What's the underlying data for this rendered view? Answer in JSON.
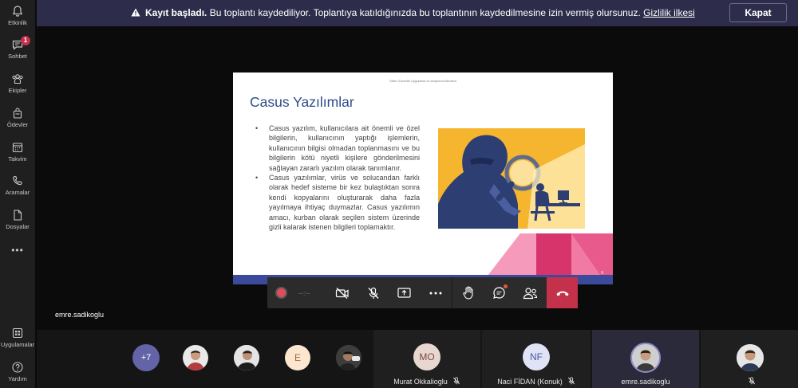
{
  "rail": {
    "items": [
      {
        "label": "Etkinlik",
        "icon": "bell-icon"
      },
      {
        "label": "Sohbet",
        "icon": "chat-icon",
        "badge": "1"
      },
      {
        "label": "Ekipler",
        "icon": "teams-icon"
      },
      {
        "label": "Ödevler",
        "icon": "assignments-icon"
      },
      {
        "label": "Takvim",
        "icon": "calendar-icon"
      },
      {
        "label": "Aramalar",
        "icon": "phone-icon"
      },
      {
        "label": "Dosyalar",
        "icon": "files-icon"
      }
    ],
    "more": "•••",
    "bottom": [
      {
        "label": "Uygulamalar",
        "icon": "apps-icon"
      },
      {
        "label": "Yardım",
        "icon": "help-icon"
      }
    ]
  },
  "banner": {
    "bold": "Kayıt başladı.",
    "text": " Bu toplantı kaydediliyor. Toplantıya katıldığınızda bu toplantının kaydedilmesine izin vermiş olursunuz. ",
    "link": "Gizlilik ilkesi",
    "close_label": "Kapat"
  },
  "slide": {
    "header": "Siber Güvenlik Uygulama ve Araştırma Merkezi",
    "title": "Casus Yazılımlar",
    "bullets": [
      "Casus yazılım, kullanıcılara ait önemli ve özel bilgilerin, kullanıcının yaptığı işlemlerin, kullanıcının bilgisi olmadan toplanmasını ve bu bilgilerin kötü niyetli kişilere gönderilmesini sağlayan zararlı yazılım olarak tanımlanır.",
      "Casus yazılımlar, virüs ve solucandan farklı olarak hedef sisteme bir kez bulaştıktan sonra kendi kopyalarını oluşturarak daha fazla yayılmaya ihtiyaç duymazlar. Casus yazılımın amacı, kurban olarak seçilen sistem üzerinde gizli kalarak istenen bilgileri toplamaktır."
    ],
    "page": "9"
  },
  "controls": {
    "rec_time": "--:--",
    "items": [
      "camera-off-icon",
      "mic-off-icon",
      "share-icon",
      "more-icon",
      "raise-hand-icon",
      "chat-icon",
      "participants-icon",
      "hang-up-icon"
    ]
  },
  "presenter_name": "emre.sadikoglu",
  "participants": {
    "overflow": "+7",
    "initial_E": "E",
    "tiles": [
      {
        "initials": "MO",
        "name": "Murat Okkalioglu",
        "muted": true
      },
      {
        "initials": "NF",
        "name": "Naci FİDAN (Konuk)",
        "muted": true
      },
      {
        "initials": "",
        "name": "emre.sadikoglu",
        "muted": false
      },
      {
        "initials": "",
        "name": "",
        "muted": true
      }
    ]
  },
  "colors": {
    "banner": "#2d2c4a",
    "accent": "#6264a7",
    "hangup": "#c4314b",
    "slide_title": "#2f4c8a",
    "slide_image_bg": "#f5b52e"
  }
}
